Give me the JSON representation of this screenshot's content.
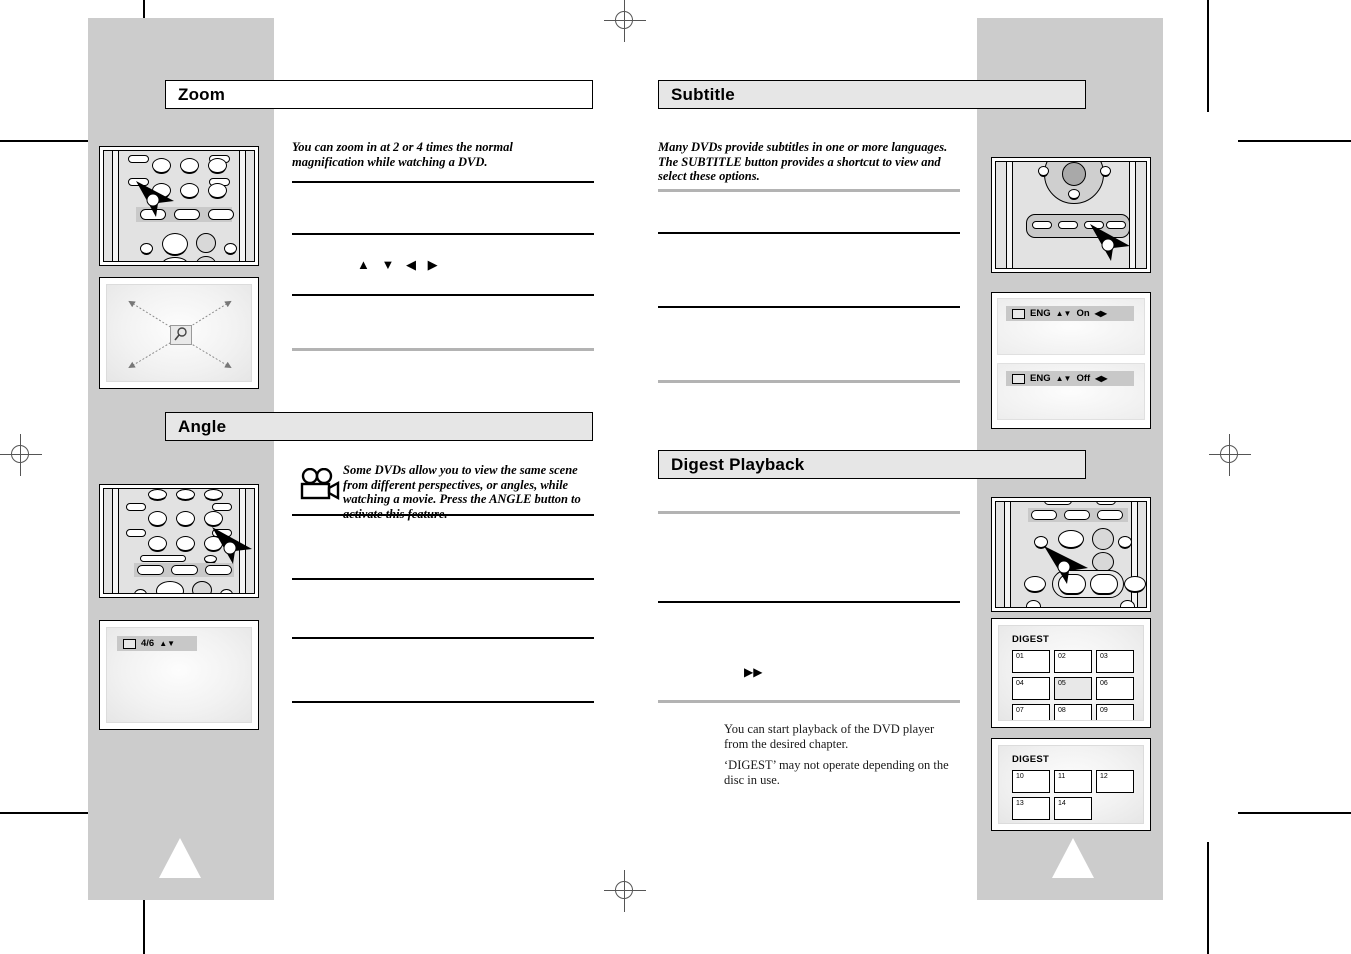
{
  "document": {
    "type": "dvd-player-user-manual-spread",
    "left_page": {
      "sections": [
        {
          "heading": "Zoom",
          "intro": "You can zoom in at 2 or 4 times the normal magnification while watching a DVD.",
          "nav_arrows": "▲ ▼ ◀ ▶",
          "figures": {
            "remote_caption": "remote-control-zoom-button",
            "screen_caption": "tv-screen-zoom-directions"
          }
        },
        {
          "heading": "Angle",
          "intro": "Some DVDs allow you to view the same scene from different perspectives, or angles, while watching a movie. Press the ANGLE button to activate this feature.",
          "icon": "movie-camera-icon",
          "osd": {
            "icon": "angle-camera-icon",
            "value": "4/6",
            "arrows": "▲▼"
          }
        }
      ]
    },
    "right_page": {
      "sections": [
        {
          "heading": "Subtitle",
          "intro": "Many DVDs provide subtitles in one or more languages. The SUBTITLE button provides a shortcut to view and select these options.",
          "osd_screens": [
            {
              "icon": "subtitle-icon",
              "language": "ENG",
              "updown": "▲▼",
              "state": "On",
              "leftright": "◀▶"
            },
            {
              "icon": "subtitle-icon",
              "language": "ENG",
              "updown": "▲▼",
              "state": "Off",
              "leftright": "◀▶"
            }
          ]
        },
        {
          "heading": "Digest Playback",
          "fast_forward_symbol": "▶▶",
          "notes": [
            "You can start playback of the DVD player from the desired chapter.",
            "‘DIGEST’ may not operate depending on the disc in use."
          ],
          "digest_screens": [
            {
              "title": "DIGEST",
              "chapters": [
                "01",
                "02",
                "03",
                "04",
                "05",
                "06",
                "07",
                "08",
                "09"
              ],
              "selected": "05"
            },
            {
              "title": "DIGEST",
              "chapters": [
                "10",
                "11",
                "12",
                "13",
                "14"
              ],
              "selected": ""
            }
          ]
        }
      ]
    }
  },
  "colors": {
    "page_background": "#ffffff",
    "gray_column": "#cccccc",
    "rule_black": "#000000",
    "rule_gray": "#b3b3b3",
    "osd_bar": "#c8c8c8",
    "remote_body": "#e2e2e2"
  },
  "print_marks": {
    "registration": "crosshair-circle",
    "crop": "corner-crop-mark",
    "page_triangle": "white-triangle-marker"
  }
}
